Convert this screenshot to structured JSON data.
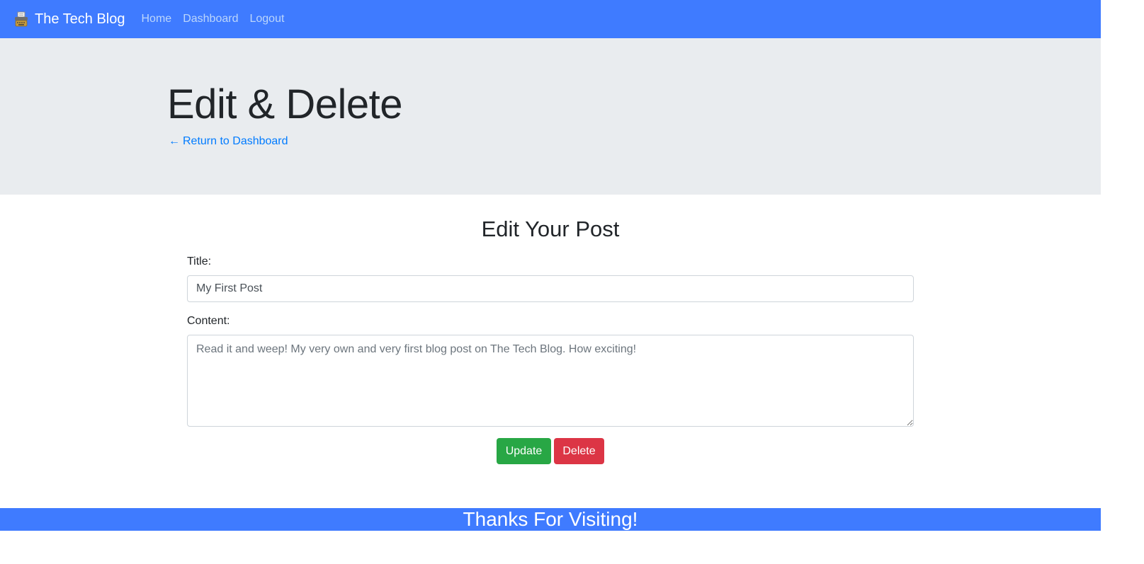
{
  "colors": {
    "navbar": "#3f7bff",
    "hero_bg": "#e9ecef",
    "link": "#007bff",
    "nav_link": "#bcd6fb",
    "update_button": "#28a745",
    "delete_button": "#dc3545",
    "footer": "#3f7bff"
  },
  "navbar": {
    "brand_icon": "typewriter-icon",
    "brand": "The Tech Blog",
    "links": [
      "Home",
      "Dashboard",
      "Logout"
    ]
  },
  "hero": {
    "title": "Edit & Delete",
    "back_arrow": "←",
    "back_link": "Return to Dashboard"
  },
  "form": {
    "heading": "Edit Your Post",
    "title_label": "Title:",
    "title_value": "My First Post",
    "content_label": "Content:",
    "content_value": "Read it and weep! My very own and very first blog post on The Tech Blog. How exciting!",
    "update_label": "Update",
    "delete_label": "Delete"
  },
  "footer": {
    "text": "Thanks For Visiting!"
  }
}
